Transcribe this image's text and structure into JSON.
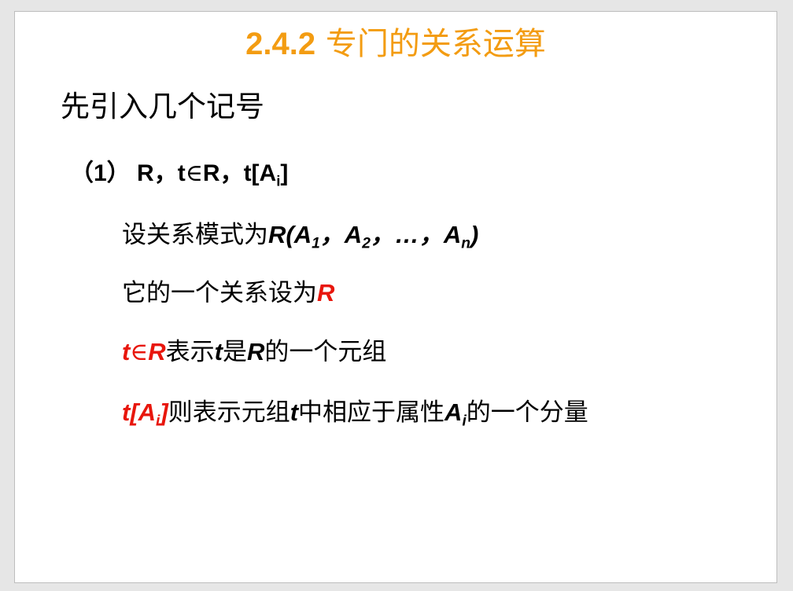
{
  "slide": {
    "title_number": "2.4.2",
    "title_text": " 专门的关系运算",
    "intro": "先引入几个记号",
    "item1": {
      "label": "（1）",
      "R1": "R，t",
      "in": "∈",
      "R2": "R，t[A",
      "sub": "i",
      "close": "]"
    },
    "lines": {
      "schema_text": "设关系模式为",
      "schema_formula_start": "R(A",
      "sub1": "1",
      "sep1": "，A",
      "sub2": "2",
      "sep2": "，…，A",
      "subn": "n",
      "schema_close": ")",
      "relation_text": "它的一个关系设为",
      "relation_symbol": "R",
      "tuple_t": "t",
      "tuple_in": "∈",
      "tuple_R": "R",
      "tuple_text1": "表示",
      "tuple_t2": "t",
      "tuple_text2": "是",
      "tuple_R2": "R",
      "tuple_text3": "的一个元组",
      "comp_start": "t[A",
      "comp_sub": "i",
      "comp_close": "]",
      "comp_text1": "则表示元组",
      "comp_t": "t",
      "comp_text2": "中相应于属性",
      "comp_A": "A",
      "comp_sub2": "i",
      "comp_text3": "的一个分量"
    }
  },
  "colors": {
    "title": "#f39c12",
    "highlight": "#e8160c",
    "text": "#000000"
  }
}
